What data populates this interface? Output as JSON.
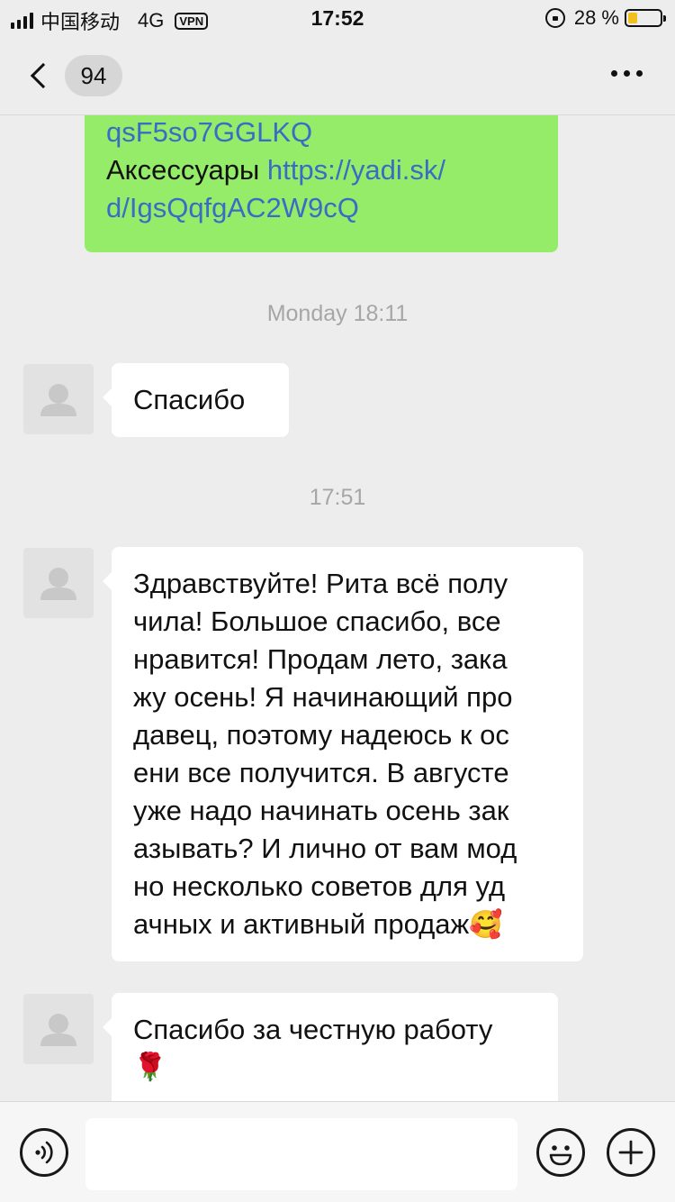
{
  "status_bar": {
    "carrier": "中国移动",
    "network": "4G",
    "vpn": "VPN",
    "time": "17:52",
    "battery_text": "28 %",
    "battery_level": 0.28,
    "battery_color": "#f2c01c"
  },
  "nav": {
    "unread_count": "94",
    "back_icon": "chevron-left-icon",
    "more_icon": "more-icon"
  },
  "messages": {
    "outgoing_1": {
      "line1": "qsF5so7GGLKQ",
      "label": "Аксессуары",
      "link_part1": "https://yadi.sk/",
      "link_part2": "d/IgsQqfgAC2W9cQ"
    },
    "time_1": "Monday 18:11",
    "incoming_1": "Спасибо",
    "time_2": "17:51",
    "incoming_2": {
      "lines": [
        "Здравствуйте! Рита всё полу",
        "чила! Большое спасибо, все",
        "нравится! Продам лето, зака",
        "жу осень! Я начинающий про",
        "давец, поэтому надеюсь к ос",
        "ени все получится. В августе",
        "уже надо начинать осень зак",
        "азывать? И лично от вам мод",
        "но несколько советов для уд",
        "ачных и активный продаж"
      ],
      "emoji": "🥰"
    },
    "incoming_3": {
      "text": "Спасибо за честную работу",
      "emoji": "🌹"
    }
  },
  "colors": {
    "outgoing_bubble": "#95ec69",
    "incoming_bubble": "#ffffff",
    "link": "#3b6cc5",
    "background": "#ededed"
  },
  "input_bar": {
    "value": "",
    "voice_icon": "voice-icon",
    "emoji_icon": "emoji-icon",
    "add_icon": "plus-icon"
  }
}
